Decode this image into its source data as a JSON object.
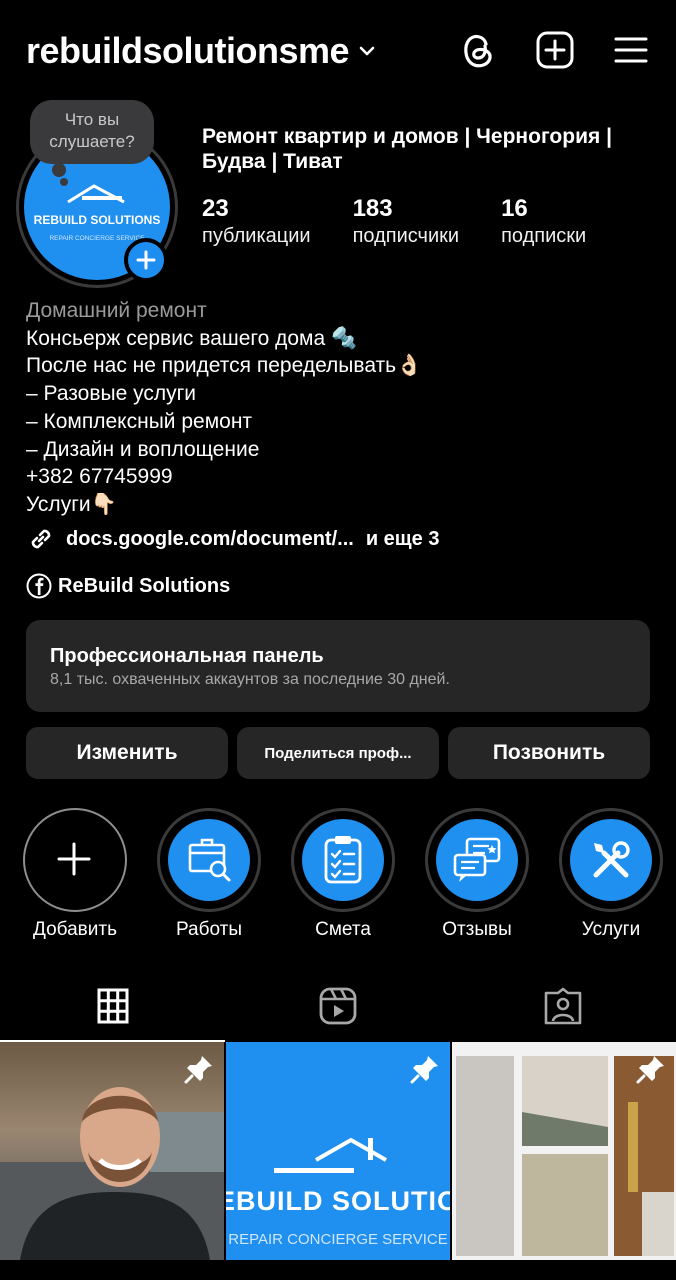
{
  "header": {
    "username": "rebuildsolutionsme",
    "icons": [
      "chevron-down-icon",
      "threads-icon",
      "plus-square-icon",
      "menu-icon"
    ]
  },
  "note": {
    "text": "Что вы слушаете?"
  },
  "avatar": {
    "brand_title": "REBUILD SOLUTIONS",
    "brand_subtitle": "REPAIR CONCIERGE SERVICE",
    "accent": "#1f8ff0"
  },
  "profile": {
    "name": "Ремонт квартир и домов | Черногория | Будва | Тиват",
    "stats": [
      {
        "count": "23",
        "label": "публикации"
      },
      {
        "count": "183",
        "label": "подписчики"
      },
      {
        "count": "16",
        "label": "подписки"
      }
    ]
  },
  "bio": {
    "category": "Домашний ремонт",
    "lines": [
      "Консьерж сервис вашего дома 🔩",
      "После нас не придется переделывать👌🏻",
      "– Разовые услуги",
      "– Комплексный ремонт",
      "– Дизайн и воплощение",
      "+382 67745999",
      "Услуги👇🏻"
    ],
    "link": "docs.google.com/document/...",
    "link_more": "и еще 3",
    "facebook": "ReBuild Solutions"
  },
  "pro_panel": {
    "title": "Профессиональная панель",
    "subtitle": "8,1 тыс. охваченных аккаунтов за последние 30 дней."
  },
  "buttons": {
    "edit": "Изменить",
    "share": "Поделиться проф...",
    "call": "Позвонить"
  },
  "highlights": [
    {
      "label": "Добавить",
      "icon": "plus-icon"
    },
    {
      "label": "Работы",
      "icon": "blueprint-icon"
    },
    {
      "label": "Смета",
      "icon": "checklist-icon"
    },
    {
      "label": "Отзывы",
      "icon": "chat-bubbles-icon"
    },
    {
      "label": "Услуги",
      "icon": "tools-icon"
    }
  ],
  "tabs": [
    "grid-icon",
    "reels-icon",
    "tagged-icon"
  ],
  "posts": [
    {
      "name": "post-portrait",
      "pinned": true
    },
    {
      "name": "post-logo",
      "pinned": true,
      "text1": "EBUILD SOLUTIO",
      "text2": "REPAIR CONCIERGE SERVICE"
    },
    {
      "name": "post-collage",
      "pinned": true
    }
  ]
}
